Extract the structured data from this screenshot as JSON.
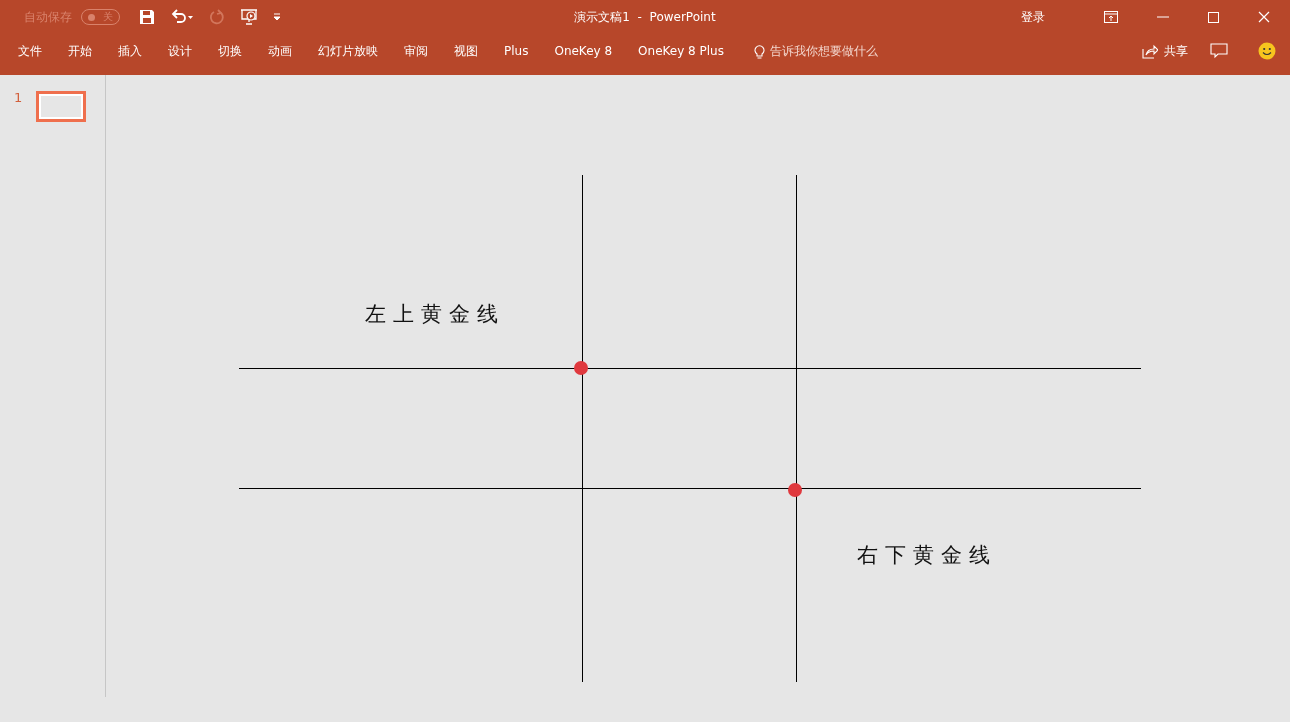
{
  "window": {
    "title": "演示文稿1  -  PowerPoint",
    "account": "登录"
  },
  "autosave": {
    "label": "自动保存",
    "on": false,
    "state_label": "关"
  },
  "ribbon_tabs": [
    "文件",
    "开始",
    "插入",
    "设计",
    "切换",
    "动画",
    "幻灯片放映",
    "审阅",
    "视图",
    "Plus",
    "OneKey 8",
    "OneKey 8 Plus"
  ],
  "tell_me": {
    "placeholder": "告诉我你想要做什么"
  },
  "share": "共享",
  "slides": [
    {
      "number": "1",
      "selected": true
    }
  ],
  "slide_labels": [
    "左上黄金线",
    "右下黄金线"
  ]
}
